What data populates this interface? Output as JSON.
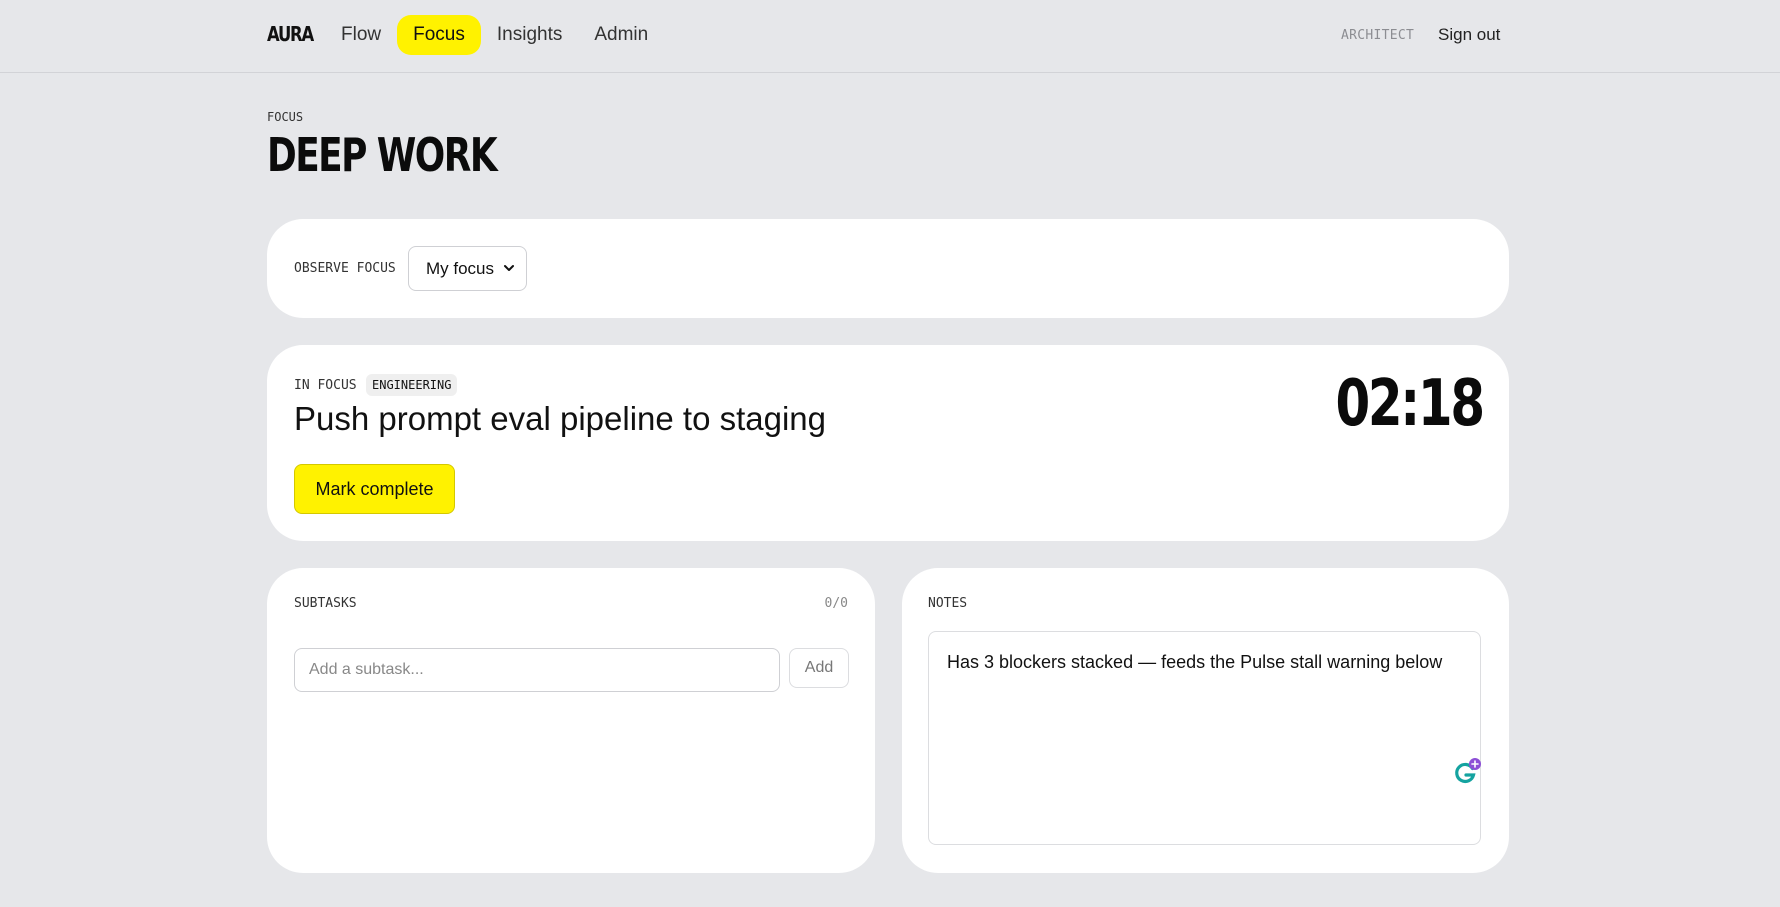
{
  "header": {
    "brand": "AURA",
    "nav": [
      {
        "label": "Flow",
        "active": false
      },
      {
        "label": "Focus",
        "active": true
      },
      {
        "label": "Insights",
        "active": false
      },
      {
        "label": "Admin",
        "active": false
      }
    ],
    "role": "ARCHITECT",
    "signout": "Sign out"
  },
  "page": {
    "eyebrow": "FOCUS",
    "title": "DEEP WORK"
  },
  "observe": {
    "label": "OBSERVE FOCUS",
    "selected": "My focus"
  },
  "focus": {
    "label": "IN FOCUS",
    "tag": "ENGINEERING",
    "task": "Push prompt eval pipeline to staging",
    "timer": "02:18",
    "complete_label": "Mark complete"
  },
  "subtasks": {
    "label": "SUBTASKS",
    "count": "0/0",
    "placeholder": "Add a subtask...",
    "add_label": "Add"
  },
  "notes": {
    "label": "NOTES",
    "text": "Has 3 blockers stacked — feeds the Pulse stall warning below"
  },
  "colors": {
    "accent": "#fff200",
    "background": "#e6e7ea",
    "card": "#ffffff"
  }
}
